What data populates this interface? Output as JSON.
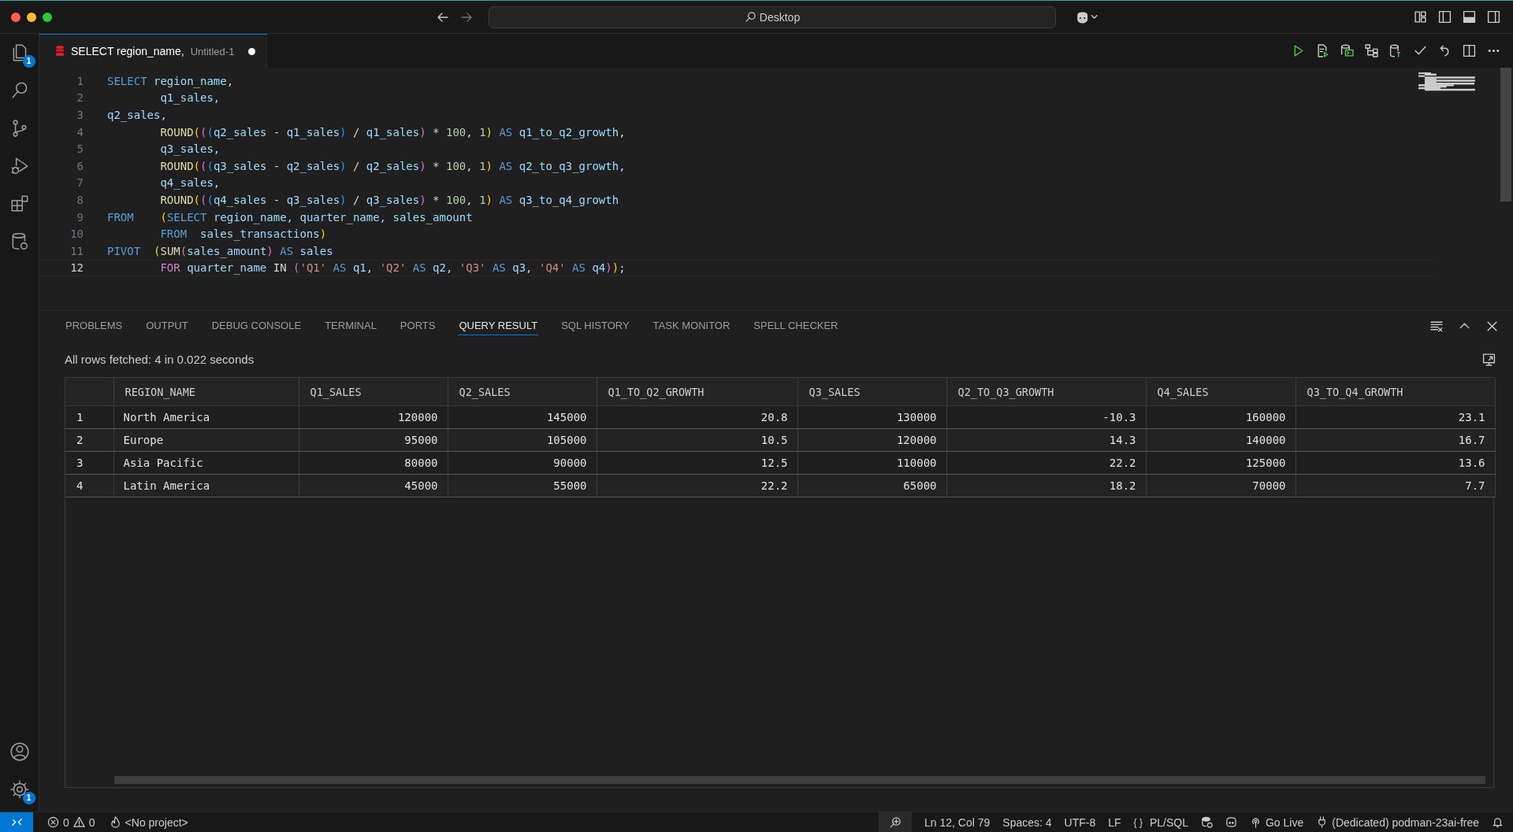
{
  "window": {
    "search": "Desktop"
  },
  "activity_bar": {
    "top": [
      {
        "kind": "files",
        "badge": "1"
      },
      {
        "kind": "search"
      },
      {
        "kind": "source-control"
      },
      {
        "kind": "run-debug"
      },
      {
        "kind": "extensions"
      },
      {
        "kind": "database"
      }
    ],
    "bottom": [
      {
        "kind": "account"
      },
      {
        "kind": "settings",
        "badge": "1"
      }
    ]
  },
  "editor_tab": {
    "title": "SELECT region_name,",
    "description": "Untitled-1",
    "modified": true
  },
  "code": {
    "lines": [
      {
        "number": "1",
        "selected": false,
        "tokens": [
          {
            "kind": "kw",
            "text": "SELECT"
          },
          {
            "kind": "id",
            "text": " region_name,"
          }
        ]
      },
      {
        "number": "2",
        "selected": false,
        "tokens": [
          {
            "kind": "id",
            "text": "        q1_sales,"
          }
        ]
      },
      {
        "number": "3",
        "selected": false,
        "tokens": [
          {
            "kind": "id",
            "text": "q2_sales,"
          }
        ]
      },
      {
        "number": "4",
        "selected": false,
        "tokens": [
          {
            "kind": "fn",
            "text": "        ROUND"
          },
          {
            "kind": "p1",
            "text": "("
          },
          {
            "kind": "p2",
            "text": "("
          },
          {
            "kind": "p3",
            "text": "("
          },
          {
            "kind": "id",
            "text": "q2_sales"
          },
          {
            "kind": "op",
            "text": " - "
          },
          {
            "kind": "id",
            "text": "q1_sales"
          },
          {
            "kind": "p3",
            "text": ")"
          },
          {
            "kind": "op",
            "text": " / "
          },
          {
            "kind": "id",
            "text": "q1_sales"
          },
          {
            "kind": "p2",
            "text": ")"
          },
          {
            "kind": "op",
            "text": " * "
          },
          {
            "kind": "num",
            "text": "100"
          },
          {
            "kind": "op",
            "text": ", "
          },
          {
            "kind": "num",
            "text": "1"
          },
          {
            "kind": "p1",
            "text": ")"
          },
          {
            "kind": "kw",
            "text": " AS"
          },
          {
            "kind": "id",
            "text": " q1_to_q2_growth"
          },
          {
            "kind": "op",
            "text": ","
          }
        ]
      },
      {
        "number": "5",
        "selected": false,
        "tokens": [
          {
            "kind": "id",
            "text": "        q3_sales,"
          }
        ]
      },
      {
        "number": "6",
        "selected": false,
        "tokens": [
          {
            "kind": "fn",
            "text": "        ROUND"
          },
          {
            "kind": "p1",
            "text": "("
          },
          {
            "kind": "p2",
            "text": "("
          },
          {
            "kind": "p3",
            "text": "("
          },
          {
            "kind": "id",
            "text": "q3_sales"
          },
          {
            "kind": "op",
            "text": " - "
          },
          {
            "kind": "id",
            "text": "q2_sales"
          },
          {
            "kind": "p3",
            "text": ")"
          },
          {
            "kind": "op",
            "text": " / "
          },
          {
            "kind": "id",
            "text": "q2_sales"
          },
          {
            "kind": "p2",
            "text": ")"
          },
          {
            "kind": "op",
            "text": " * "
          },
          {
            "kind": "num",
            "text": "100"
          },
          {
            "kind": "op",
            "text": ", "
          },
          {
            "kind": "num",
            "text": "1"
          },
          {
            "kind": "p1",
            "text": ")"
          },
          {
            "kind": "kw",
            "text": " AS"
          },
          {
            "kind": "id",
            "text": " q2_to_q3_growth"
          },
          {
            "kind": "op",
            "text": ","
          }
        ]
      },
      {
        "number": "7",
        "selected": false,
        "tokens": [
          {
            "kind": "id",
            "text": "        q4_sales,"
          }
        ]
      },
      {
        "number": "8",
        "selected": false,
        "tokens": [
          {
            "kind": "fn",
            "text": "        ROUND"
          },
          {
            "kind": "p1",
            "text": "("
          },
          {
            "kind": "p2",
            "text": "("
          },
          {
            "kind": "p3",
            "text": "("
          },
          {
            "kind": "id",
            "text": "q4_sales"
          },
          {
            "kind": "op",
            "text": " - "
          },
          {
            "kind": "id",
            "text": "q3_sales"
          },
          {
            "kind": "p3",
            "text": ")"
          },
          {
            "kind": "op",
            "text": " / "
          },
          {
            "kind": "id",
            "text": "q3_sales"
          },
          {
            "kind": "p2",
            "text": ")"
          },
          {
            "kind": "op",
            "text": " * "
          },
          {
            "kind": "num",
            "text": "100"
          },
          {
            "kind": "op",
            "text": ", "
          },
          {
            "kind": "num",
            "text": "1"
          },
          {
            "kind": "p1",
            "text": ")"
          },
          {
            "kind": "kw",
            "text": " AS"
          },
          {
            "kind": "id",
            "text": " q3_to_q4_growth"
          }
        ]
      },
      {
        "number": "9",
        "selected": false,
        "tokens": [
          {
            "kind": "kw",
            "text": "FROM"
          },
          {
            "kind": "p1",
            "text": "    ("
          },
          {
            "kind": "kw",
            "text": "SELECT"
          },
          {
            "kind": "id",
            "text": " region_name, quarter_name, sales_amount"
          }
        ]
      },
      {
        "number": "10",
        "selected": false,
        "tokens": [
          {
            "kind": "kw",
            "text": "        FROM"
          },
          {
            "kind": "id",
            "text": "  sales_transactions"
          },
          {
            "kind": "p1",
            "text": ")"
          }
        ]
      },
      {
        "number": "11",
        "selected": false,
        "tokens": [
          {
            "kind": "kw",
            "text": "PIVOT"
          },
          {
            "kind": "p1",
            "text": "  ("
          },
          {
            "kind": "fn",
            "text": "SUM"
          },
          {
            "kind": "p2",
            "text": "("
          },
          {
            "kind": "id",
            "text": "sales_amount"
          },
          {
            "kind": "p2",
            "text": ")"
          },
          {
            "kind": "kw",
            "text": " AS"
          },
          {
            "kind": "id",
            "text": " sales"
          }
        ]
      },
      {
        "number": "12",
        "selected": true,
        "tokens": [
          {
            "kind": "ctl",
            "text": "        FOR"
          },
          {
            "kind": "id",
            "text": " quarter_name"
          },
          {
            "kind": "op",
            "text": " IN "
          },
          {
            "kind": "p2",
            "text": "("
          },
          {
            "kind": "str",
            "text": "'Q1'"
          },
          {
            "kind": "kw",
            "text": " AS"
          },
          {
            "kind": "id",
            "text": " q1"
          },
          {
            "kind": "op",
            "text": ", "
          },
          {
            "kind": "str",
            "text": "'Q2'"
          },
          {
            "kind": "kw",
            "text": " AS"
          },
          {
            "kind": "id",
            "text": " q2"
          },
          {
            "kind": "op",
            "text": ", "
          },
          {
            "kind": "str",
            "text": "'Q3'"
          },
          {
            "kind": "kw",
            "text": " AS"
          },
          {
            "kind": "id",
            "text": " q3"
          },
          {
            "kind": "op",
            "text": ", "
          },
          {
            "kind": "str",
            "text": "'Q4'"
          },
          {
            "kind": "kw",
            "text": " AS"
          },
          {
            "kind": "id",
            "text": " q4"
          },
          {
            "kind": "p2",
            "text": ")"
          },
          {
            "kind": "p1",
            "text": ")"
          },
          {
            "kind": "op",
            "text": ";"
          }
        ]
      }
    ]
  },
  "panel": {
    "tabs": [
      {
        "label": "PROBLEMS",
        "selected": false
      },
      {
        "label": "OUTPUT",
        "selected": false
      },
      {
        "label": "DEBUG CONSOLE",
        "selected": false
      },
      {
        "label": "TERMINAL",
        "selected": false
      },
      {
        "label": "PORTS",
        "selected": false
      },
      {
        "label": "QUERY RESULT",
        "selected": true
      },
      {
        "label": "SQL HISTORY",
        "selected": false
      },
      {
        "label": "TASK MONITOR",
        "selected": false
      },
      {
        "label": "SPELL CHECKER",
        "selected": false
      }
    ],
    "status": "All rows fetched: 4 in 0.022 seconds",
    "table": {
      "columns": [
        {
          "label": "REGION_NAME",
          "kind": "text"
        },
        {
          "label": "Q1_SALES",
          "kind": "number"
        },
        {
          "label": "Q2_SALES",
          "kind": "number"
        },
        {
          "label": "Q1_TO_Q2_GROWTH",
          "kind": "number"
        },
        {
          "label": "Q3_SALES",
          "kind": "number"
        },
        {
          "label": "Q2_TO_Q3_GROWTH",
          "kind": "number"
        },
        {
          "label": "Q4_SALES",
          "kind": "number"
        },
        {
          "label": "Q3_TO_Q4_GROWTH",
          "kind": "number"
        }
      ],
      "rows": [
        {
          "number": "1",
          "cells": [
            "North America",
            "120000",
            "145000",
            "20.8",
            "130000",
            "-10.3",
            "160000",
            "23.1"
          ]
        },
        {
          "number": "2",
          "cells": [
            "Europe",
            "95000",
            "105000",
            "10.5",
            "120000",
            "14.3",
            "140000",
            "16.7"
          ]
        },
        {
          "number": "3",
          "cells": [
            "Asia Pacific",
            "80000",
            "90000",
            "12.5",
            "110000",
            "22.2",
            "125000",
            "13.6"
          ]
        },
        {
          "number": "4",
          "cells": [
            "Latin America",
            "45000",
            "55000",
            "22.2",
            "65000",
            "18.2",
            "70000",
            "7.7"
          ]
        }
      ]
    }
  },
  "status_bar": {
    "errors": "0",
    "warnings": "0",
    "project": "<No project>",
    "position": "Ln 12, Col 79",
    "indent": "Spaces: 4",
    "encoding": "UTF-8",
    "eol": "LF",
    "language_icon": "{ }",
    "language": "PL/SQL",
    "live": "Go Live",
    "connection": "(Dedicated) podman-23ai-free"
  }
}
